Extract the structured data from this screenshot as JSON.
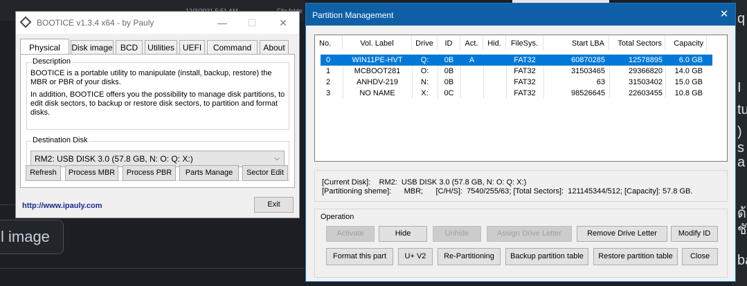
{
  "background": {
    "date_text": "12/3/2021 5:51 AM",
    "folder_text": "File folde",
    "image_button_label": "l image",
    "right_glyphs": [
      "q",
      "I",
      "tu",
      ") s",
      "a",
      "ด้",
      "ชั",
      "ba"
    ]
  },
  "bootice": {
    "title": "BOOTICE v1.3.4 x64 - by Pauly",
    "tabs": [
      "Physical disk",
      "Disk image",
      "BCD",
      "Utilities",
      "UEFI",
      "Command line",
      "About"
    ],
    "description_label": "Description",
    "description_p1": "BOOTICE is a portable utility to manipulate (install, backup, restore) the MBR or PBR of your disks.",
    "description_p2": "In addition, BOOTICE offers you the possibility to manage disk partitions, to edit disk sectors, to backup or restore disk sectors, to partition and format disks.",
    "destination_label": "Destination Disk",
    "destination_value": "RM2:  USB DISK 3.0 (57.8 GB, N: O: Q: X:)",
    "buttons": {
      "refresh": "Refresh",
      "process_mbr": "Process MBR",
      "process_pbr": "Process PBR",
      "parts_manage": "Parts Manage",
      "sector_edit": "Sector Edit"
    },
    "url": "http://www.ipauly.com",
    "exit": "Exit"
  },
  "partition": {
    "title": "Partition Management",
    "columns": [
      "No.",
      "Vol. Label",
      "Drive",
      "ID",
      "Act.",
      "Hid.",
      "FileSys.",
      "Start LBA",
      "Total Sectors",
      "Capacity"
    ],
    "rows": [
      {
        "no": "0",
        "label": "WIN11PE-HVT",
        "drive": "Q:",
        "id": "0B",
        "act": "A",
        "hid": "",
        "fs": "FAT32",
        "start": "60870285",
        "total": "12578895",
        "cap": "6.0 GB",
        "selected": true
      },
      {
        "no": "1",
        "label": "MCBOOT281",
        "drive": "O:",
        "id": "0B",
        "act": "",
        "hid": "",
        "fs": "FAT32",
        "start": "31503465",
        "total": "29366820",
        "cap": "14.0 GB",
        "selected": false
      },
      {
        "no": "2",
        "label": "ANHDV-219",
        "drive": "N:",
        "id": "0B",
        "act": "",
        "hid": "",
        "fs": "FAT32",
        "start": "63",
        "total": "31503402",
        "cap": "15.0 GB",
        "selected": false
      },
      {
        "no": "3",
        "label": "NO NAME",
        "drive": "X:",
        "id": "0C",
        "act": "",
        "hid": "",
        "fs": "FAT32",
        "start": "98526645",
        "total": "22603455",
        "cap": "10.8 GB",
        "selected": false
      }
    ],
    "current_disk_line": "[Current Disk]:    RM2:  USB DISK 3.0 (57.8 GB, N: O: Q: X:)",
    "partitioning_line": "[Partitioning sheme]:      MBR;      [C/H/S]:  7540/255/63; [Total Sectors]:  121145344/512; [Capacity]: 57.8 GB.",
    "operation_label": "Operation",
    "buttons": {
      "activate": "Activate",
      "hide": "Hide",
      "unhide": "Unhide",
      "assign_drive_letter": "Assign Drive Letter",
      "remove_drive_letter": "Remove Drive Letter",
      "modify_id": "Modify ID",
      "format_this_part": "Format this part",
      "u_v2": "U+ V2",
      "re_partitioning": "Re-Partitioning",
      "backup_partition_table": "Backup partition table",
      "restore_partition_table": "Restore partition table",
      "close": "Close"
    }
  }
}
